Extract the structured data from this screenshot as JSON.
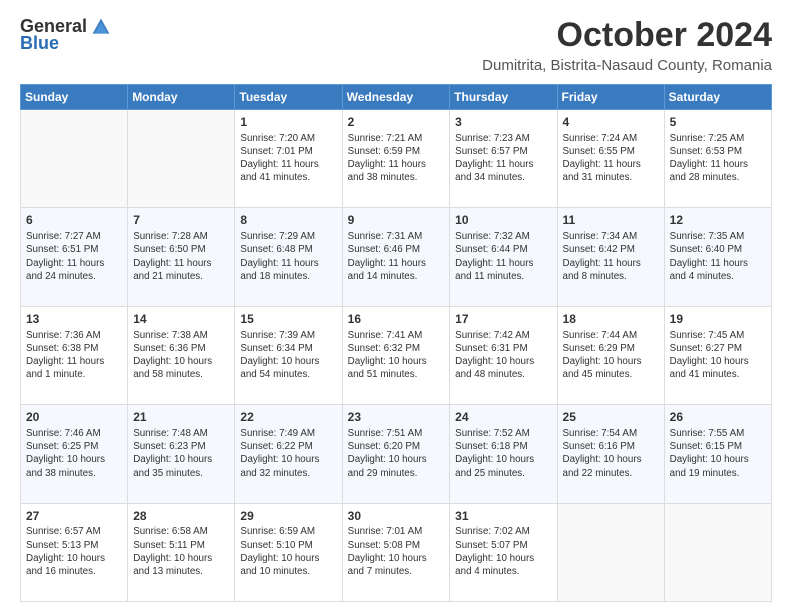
{
  "logo": {
    "general": "General",
    "blue": "Blue",
    "tagline": ""
  },
  "header": {
    "month": "October 2024",
    "location": "Dumitrita, Bistrita-Nasaud County, Romania"
  },
  "days_of_week": [
    "Sunday",
    "Monday",
    "Tuesday",
    "Wednesday",
    "Thursday",
    "Friday",
    "Saturday"
  ],
  "weeks": [
    [
      {
        "day": "",
        "info": ""
      },
      {
        "day": "",
        "info": ""
      },
      {
        "day": "1",
        "info": "Sunrise: 7:20 AM\nSunset: 7:01 PM\nDaylight: 11 hours and 41 minutes."
      },
      {
        "day": "2",
        "info": "Sunrise: 7:21 AM\nSunset: 6:59 PM\nDaylight: 11 hours and 38 minutes."
      },
      {
        "day": "3",
        "info": "Sunrise: 7:23 AM\nSunset: 6:57 PM\nDaylight: 11 hours and 34 minutes."
      },
      {
        "day": "4",
        "info": "Sunrise: 7:24 AM\nSunset: 6:55 PM\nDaylight: 11 hours and 31 minutes."
      },
      {
        "day": "5",
        "info": "Sunrise: 7:25 AM\nSunset: 6:53 PM\nDaylight: 11 hours and 28 minutes."
      }
    ],
    [
      {
        "day": "6",
        "info": "Sunrise: 7:27 AM\nSunset: 6:51 PM\nDaylight: 11 hours and 24 minutes."
      },
      {
        "day": "7",
        "info": "Sunrise: 7:28 AM\nSunset: 6:50 PM\nDaylight: 11 hours and 21 minutes."
      },
      {
        "day": "8",
        "info": "Sunrise: 7:29 AM\nSunset: 6:48 PM\nDaylight: 11 hours and 18 minutes."
      },
      {
        "day": "9",
        "info": "Sunrise: 7:31 AM\nSunset: 6:46 PM\nDaylight: 11 hours and 14 minutes."
      },
      {
        "day": "10",
        "info": "Sunrise: 7:32 AM\nSunset: 6:44 PM\nDaylight: 11 hours and 11 minutes."
      },
      {
        "day": "11",
        "info": "Sunrise: 7:34 AM\nSunset: 6:42 PM\nDaylight: 11 hours and 8 minutes."
      },
      {
        "day": "12",
        "info": "Sunrise: 7:35 AM\nSunset: 6:40 PM\nDaylight: 11 hours and 4 minutes."
      }
    ],
    [
      {
        "day": "13",
        "info": "Sunrise: 7:36 AM\nSunset: 6:38 PM\nDaylight: 11 hours and 1 minute."
      },
      {
        "day": "14",
        "info": "Sunrise: 7:38 AM\nSunset: 6:36 PM\nDaylight: 10 hours and 58 minutes."
      },
      {
        "day": "15",
        "info": "Sunrise: 7:39 AM\nSunset: 6:34 PM\nDaylight: 10 hours and 54 minutes."
      },
      {
        "day": "16",
        "info": "Sunrise: 7:41 AM\nSunset: 6:32 PM\nDaylight: 10 hours and 51 minutes."
      },
      {
        "day": "17",
        "info": "Sunrise: 7:42 AM\nSunset: 6:31 PM\nDaylight: 10 hours and 48 minutes."
      },
      {
        "day": "18",
        "info": "Sunrise: 7:44 AM\nSunset: 6:29 PM\nDaylight: 10 hours and 45 minutes."
      },
      {
        "day": "19",
        "info": "Sunrise: 7:45 AM\nSunset: 6:27 PM\nDaylight: 10 hours and 41 minutes."
      }
    ],
    [
      {
        "day": "20",
        "info": "Sunrise: 7:46 AM\nSunset: 6:25 PM\nDaylight: 10 hours and 38 minutes."
      },
      {
        "day": "21",
        "info": "Sunrise: 7:48 AM\nSunset: 6:23 PM\nDaylight: 10 hours and 35 minutes."
      },
      {
        "day": "22",
        "info": "Sunrise: 7:49 AM\nSunset: 6:22 PM\nDaylight: 10 hours and 32 minutes."
      },
      {
        "day": "23",
        "info": "Sunrise: 7:51 AM\nSunset: 6:20 PM\nDaylight: 10 hours and 29 minutes."
      },
      {
        "day": "24",
        "info": "Sunrise: 7:52 AM\nSunset: 6:18 PM\nDaylight: 10 hours and 25 minutes."
      },
      {
        "day": "25",
        "info": "Sunrise: 7:54 AM\nSunset: 6:16 PM\nDaylight: 10 hours and 22 minutes."
      },
      {
        "day": "26",
        "info": "Sunrise: 7:55 AM\nSunset: 6:15 PM\nDaylight: 10 hours and 19 minutes."
      }
    ],
    [
      {
        "day": "27",
        "info": "Sunrise: 6:57 AM\nSunset: 5:13 PM\nDaylight: 10 hours and 16 minutes."
      },
      {
        "day": "28",
        "info": "Sunrise: 6:58 AM\nSunset: 5:11 PM\nDaylight: 10 hours and 13 minutes."
      },
      {
        "day": "29",
        "info": "Sunrise: 6:59 AM\nSunset: 5:10 PM\nDaylight: 10 hours and 10 minutes."
      },
      {
        "day": "30",
        "info": "Sunrise: 7:01 AM\nSunset: 5:08 PM\nDaylight: 10 hours and 7 minutes."
      },
      {
        "day": "31",
        "info": "Sunrise: 7:02 AM\nSunset: 5:07 PM\nDaylight: 10 hours and 4 minutes."
      },
      {
        "day": "",
        "info": ""
      },
      {
        "day": "",
        "info": ""
      }
    ]
  ]
}
